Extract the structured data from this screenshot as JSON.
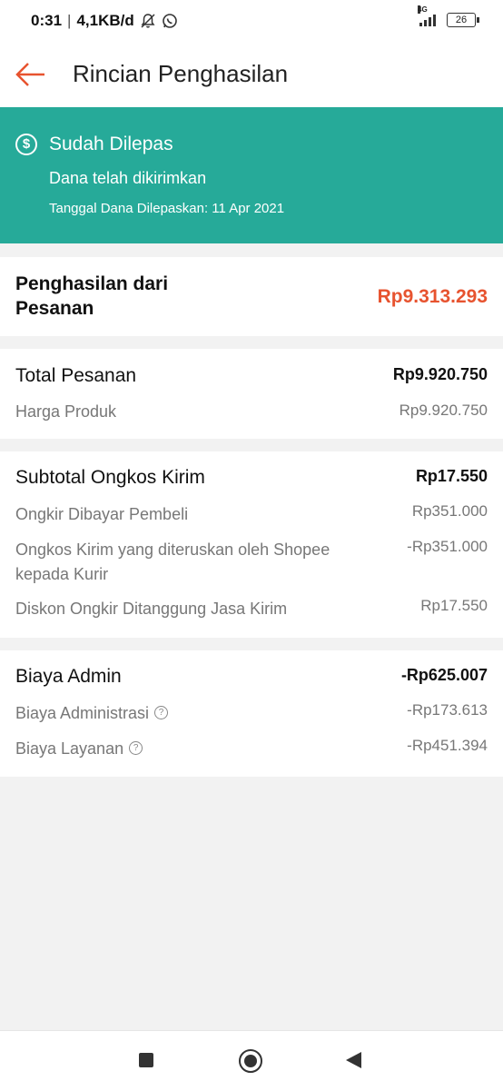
{
  "status_bar": {
    "time": "0:31",
    "speed": "4,1KB/d",
    "network": "4G",
    "battery": "26"
  },
  "header": {
    "title": "Rincian Penghasilan"
  },
  "banner": {
    "title": "Sudah Dilepas",
    "subtitle": "Dana telah dikirimkan",
    "release_date": "Tanggal Dana Dilepaskan: 11 Apr 2021",
    "color": "#26aa99"
  },
  "earnings": {
    "label_line1": "Penghasilan dari",
    "label_line2": "Pesanan",
    "value": "Rp9.313.293",
    "value_color": "#e7532f"
  },
  "order_total": {
    "label": "Total Pesanan",
    "value": "Rp9.920.750",
    "items": [
      {
        "label": "Harga Produk",
        "value": "Rp9.920.750"
      }
    ]
  },
  "shipping": {
    "label": "Subtotal Ongkos Kirim",
    "value": "Rp17.550",
    "items": [
      {
        "label": "Ongkir Dibayar Pembeli",
        "value": "Rp351.000"
      },
      {
        "label": "Ongkos Kirim yang diteruskan oleh Shopee kepada Kurir",
        "value": "-Rp351.000"
      },
      {
        "label": "Diskon Ongkir Ditanggung Jasa Kirim",
        "value": "Rp17.550"
      }
    ]
  },
  "admin": {
    "label": "Biaya Admin",
    "value": "-Rp625.007",
    "items": [
      {
        "label": "Biaya Administrasi",
        "value": "-Rp173.613"
      },
      {
        "label": "Biaya Layanan",
        "value": "-Rp451.394"
      }
    ]
  },
  "icons": {
    "back": "arrow-left-icon",
    "dollar": "dollar-circle-icon",
    "help": "question-circle-icon"
  }
}
